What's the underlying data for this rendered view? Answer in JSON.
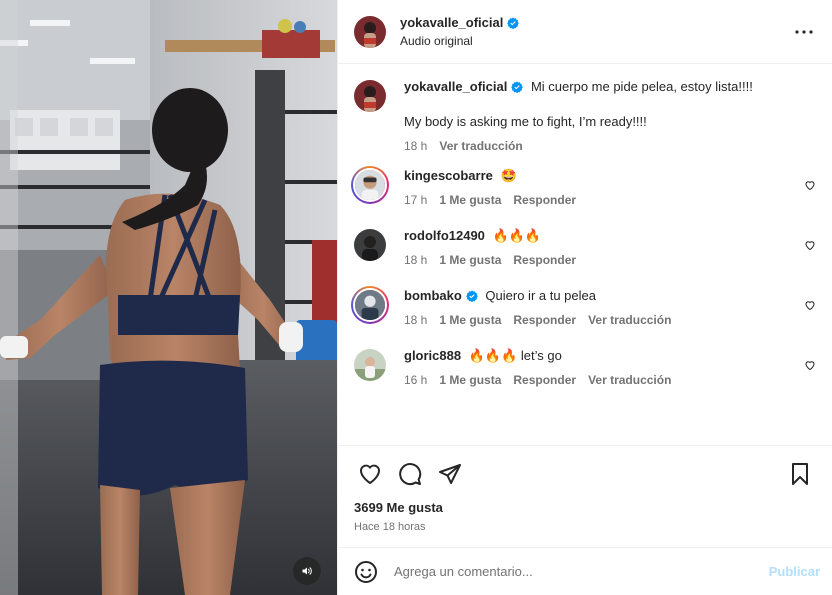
{
  "header": {
    "username": "yokavalle_oficial",
    "audio": "Audio original"
  },
  "caption": {
    "username": "yokavalle_oficial",
    "text_es": "Mi cuerpo me pide pelea, estoy lista!!!!",
    "text_en": "My body is asking me to fight, I’m ready!!!!",
    "age": "18 h",
    "translate": "Ver traducción"
  },
  "comments": [
    {
      "username": "kingescobarre",
      "text": "🤩",
      "age": "17 h",
      "likes": "1 Me gusta",
      "reply": "Responder",
      "translate": ""
    },
    {
      "username": "rodolfo12490",
      "text": "🔥🔥🔥",
      "age": "18 h",
      "likes": "1 Me gusta",
      "reply": "Responder",
      "translate": ""
    },
    {
      "username": "bombako",
      "text": "Quiero ir a tu pelea",
      "age": "18 h",
      "likes": "1 Me gusta",
      "reply": "Responder",
      "translate": "Ver traducción"
    },
    {
      "username": "gloric888",
      "text": "🔥🔥🔥 let’s go",
      "age": "16 h",
      "likes": "1 Me gusta",
      "reply": "Responder",
      "translate": "Ver traducción"
    }
  ],
  "stats": {
    "likes": "3699 Me gusta",
    "time": "Hace 18 horas"
  },
  "composer": {
    "placeholder": "Agrega un comentario...",
    "publish": "Publicar"
  },
  "colors": {
    "verified": "#0095f6",
    "publish_disabled": "#b2dffc",
    "secondary_text": "#737373"
  },
  "icons": [
    "volume-icon",
    "more-icon",
    "verified-badge-icon",
    "heart-icon",
    "comment-icon",
    "share-icon",
    "bookmark-icon",
    "emoji-icon"
  ]
}
